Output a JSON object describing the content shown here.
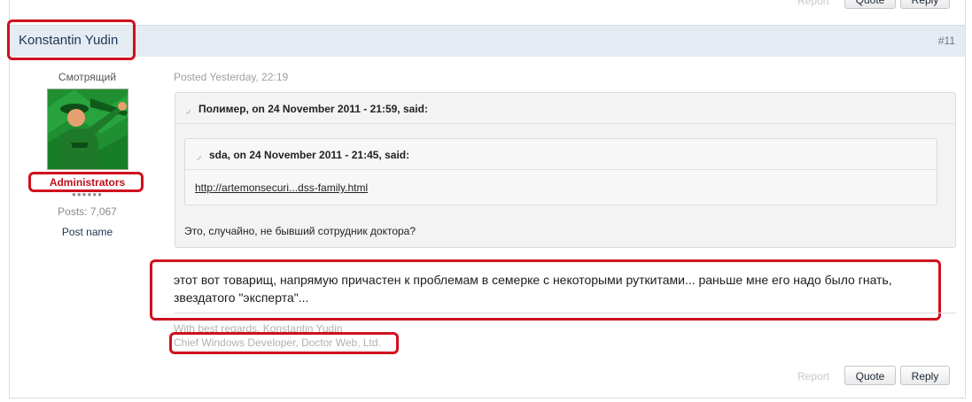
{
  "prev_post": {
    "report_label": "Report",
    "quote_label": "Quote",
    "reply_label": "Reply"
  },
  "post": {
    "author": "Konstantin Yudin",
    "number": "#11",
    "author_title": "Смотрящий",
    "group": "Administrators",
    "rank_pips": "●●●●●●",
    "posts_count": "Posts: 7,067",
    "post_name_link": "Post name",
    "posted": "Posted Yesterday, 22:19",
    "quote_outer": {
      "header": "Полимер, on 24 November 2011 - 21:59, said:",
      "body": "Это, случайно, не бывший сотрудник доктора?"
    },
    "quote_inner": {
      "header": "sda, on 24 November 2011 - 21:45, said:",
      "link": "http://artemonsecuri...dss-family.html"
    },
    "body_line1": "этот вот товарищ, напрямую причастен к проблемам в семерке с некоторыми руткитами... раньше мне его надо было гнать,",
    "body_line2": "звездатого \"эксперта\"...",
    "signature_line1": "With best regards, Konstantin Yudin",
    "signature_line2": "Chief Windows Developer, Doctor Web, Ltd.",
    "actions": {
      "report_label": "Report",
      "quote_label": "Quote",
      "reply_label": "Reply"
    }
  },
  "colors": {
    "highlight_red": "#d0101e",
    "header_bg": "#e4ebf2",
    "link_blue": "#1d3652"
  },
  "icons": {
    "quote_marker": "quote-arrow-icon",
    "avatar": "soldier-pointing-avatar"
  }
}
